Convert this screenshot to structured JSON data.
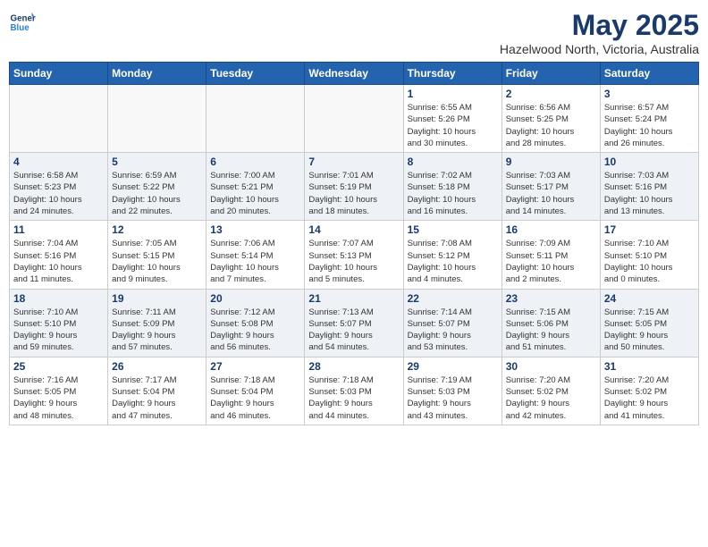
{
  "header": {
    "logo_line1": "General",
    "logo_line2": "Blue",
    "month_year": "May 2025",
    "location": "Hazelwood North, Victoria, Australia"
  },
  "weekdays": [
    "Sunday",
    "Monday",
    "Tuesday",
    "Wednesday",
    "Thursday",
    "Friday",
    "Saturday"
  ],
  "weeks": [
    [
      {
        "day": "",
        "info": ""
      },
      {
        "day": "",
        "info": ""
      },
      {
        "day": "",
        "info": ""
      },
      {
        "day": "",
        "info": ""
      },
      {
        "day": "1",
        "info": "Sunrise: 6:55 AM\nSunset: 5:26 PM\nDaylight: 10 hours\nand 30 minutes."
      },
      {
        "day": "2",
        "info": "Sunrise: 6:56 AM\nSunset: 5:25 PM\nDaylight: 10 hours\nand 28 minutes."
      },
      {
        "day": "3",
        "info": "Sunrise: 6:57 AM\nSunset: 5:24 PM\nDaylight: 10 hours\nand 26 minutes."
      }
    ],
    [
      {
        "day": "4",
        "info": "Sunrise: 6:58 AM\nSunset: 5:23 PM\nDaylight: 10 hours\nand 24 minutes."
      },
      {
        "day": "5",
        "info": "Sunrise: 6:59 AM\nSunset: 5:22 PM\nDaylight: 10 hours\nand 22 minutes."
      },
      {
        "day": "6",
        "info": "Sunrise: 7:00 AM\nSunset: 5:21 PM\nDaylight: 10 hours\nand 20 minutes."
      },
      {
        "day": "7",
        "info": "Sunrise: 7:01 AM\nSunset: 5:19 PM\nDaylight: 10 hours\nand 18 minutes."
      },
      {
        "day": "8",
        "info": "Sunrise: 7:02 AM\nSunset: 5:18 PM\nDaylight: 10 hours\nand 16 minutes."
      },
      {
        "day": "9",
        "info": "Sunrise: 7:03 AM\nSunset: 5:17 PM\nDaylight: 10 hours\nand 14 minutes."
      },
      {
        "day": "10",
        "info": "Sunrise: 7:03 AM\nSunset: 5:16 PM\nDaylight: 10 hours\nand 13 minutes."
      }
    ],
    [
      {
        "day": "11",
        "info": "Sunrise: 7:04 AM\nSunset: 5:16 PM\nDaylight: 10 hours\nand 11 minutes."
      },
      {
        "day": "12",
        "info": "Sunrise: 7:05 AM\nSunset: 5:15 PM\nDaylight: 10 hours\nand 9 minutes."
      },
      {
        "day": "13",
        "info": "Sunrise: 7:06 AM\nSunset: 5:14 PM\nDaylight: 10 hours\nand 7 minutes."
      },
      {
        "day": "14",
        "info": "Sunrise: 7:07 AM\nSunset: 5:13 PM\nDaylight: 10 hours\nand 5 minutes."
      },
      {
        "day": "15",
        "info": "Sunrise: 7:08 AM\nSunset: 5:12 PM\nDaylight: 10 hours\nand 4 minutes."
      },
      {
        "day": "16",
        "info": "Sunrise: 7:09 AM\nSunset: 5:11 PM\nDaylight: 10 hours\nand 2 minutes."
      },
      {
        "day": "17",
        "info": "Sunrise: 7:10 AM\nSunset: 5:10 PM\nDaylight: 10 hours\nand 0 minutes."
      }
    ],
    [
      {
        "day": "18",
        "info": "Sunrise: 7:10 AM\nSunset: 5:10 PM\nDaylight: 9 hours\nand 59 minutes."
      },
      {
        "day": "19",
        "info": "Sunrise: 7:11 AM\nSunset: 5:09 PM\nDaylight: 9 hours\nand 57 minutes."
      },
      {
        "day": "20",
        "info": "Sunrise: 7:12 AM\nSunset: 5:08 PM\nDaylight: 9 hours\nand 56 minutes."
      },
      {
        "day": "21",
        "info": "Sunrise: 7:13 AM\nSunset: 5:07 PM\nDaylight: 9 hours\nand 54 minutes."
      },
      {
        "day": "22",
        "info": "Sunrise: 7:14 AM\nSunset: 5:07 PM\nDaylight: 9 hours\nand 53 minutes."
      },
      {
        "day": "23",
        "info": "Sunrise: 7:15 AM\nSunset: 5:06 PM\nDaylight: 9 hours\nand 51 minutes."
      },
      {
        "day": "24",
        "info": "Sunrise: 7:15 AM\nSunset: 5:05 PM\nDaylight: 9 hours\nand 50 minutes."
      }
    ],
    [
      {
        "day": "25",
        "info": "Sunrise: 7:16 AM\nSunset: 5:05 PM\nDaylight: 9 hours\nand 48 minutes."
      },
      {
        "day": "26",
        "info": "Sunrise: 7:17 AM\nSunset: 5:04 PM\nDaylight: 9 hours\nand 47 minutes."
      },
      {
        "day": "27",
        "info": "Sunrise: 7:18 AM\nSunset: 5:04 PM\nDaylight: 9 hours\nand 46 minutes."
      },
      {
        "day": "28",
        "info": "Sunrise: 7:18 AM\nSunset: 5:03 PM\nDaylight: 9 hours\nand 44 minutes."
      },
      {
        "day": "29",
        "info": "Sunrise: 7:19 AM\nSunset: 5:03 PM\nDaylight: 9 hours\nand 43 minutes."
      },
      {
        "day": "30",
        "info": "Sunrise: 7:20 AM\nSunset: 5:02 PM\nDaylight: 9 hours\nand 42 minutes."
      },
      {
        "day": "31",
        "info": "Sunrise: 7:20 AM\nSunset: 5:02 PM\nDaylight: 9 hours\nand 41 minutes."
      }
    ]
  ]
}
